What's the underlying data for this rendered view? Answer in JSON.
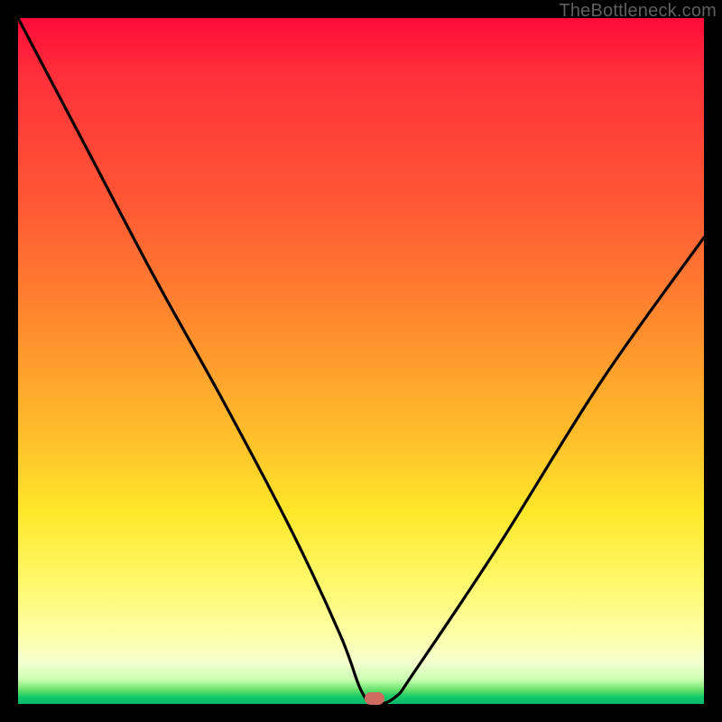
{
  "attribution": "TheBottleneck.com",
  "chart_data": {
    "type": "line",
    "title": "",
    "xlabel": "",
    "ylabel": "",
    "xlim": [
      0,
      100
    ],
    "ylim": [
      0,
      100
    ],
    "grid": false,
    "series": [
      {
        "name": "bottleneck-curve",
        "x": [
          0,
          10,
          20,
          30,
          40,
          47,
          50,
          52,
          55,
          58,
          70,
          85,
          100
        ],
        "values": [
          100,
          81,
          62,
          44,
          25,
          10,
          2,
          0,
          1,
          5,
          23,
          47,
          68
        ]
      }
    ],
    "marker": {
      "x": 52,
      "y": 0,
      "color": "#cf6b61"
    },
    "gradient_stops": [
      {
        "pos": 0,
        "color": "#ff0a3a"
      },
      {
        "pos": 28,
        "color": "#ff5a34"
      },
      {
        "pos": 62,
        "color": "#ffc22a"
      },
      {
        "pos": 82,
        "color": "#fff869"
      },
      {
        "pos": 97,
        "color": "#c9ffb0"
      },
      {
        "pos": 100,
        "color": "#05b66a"
      }
    ]
  }
}
